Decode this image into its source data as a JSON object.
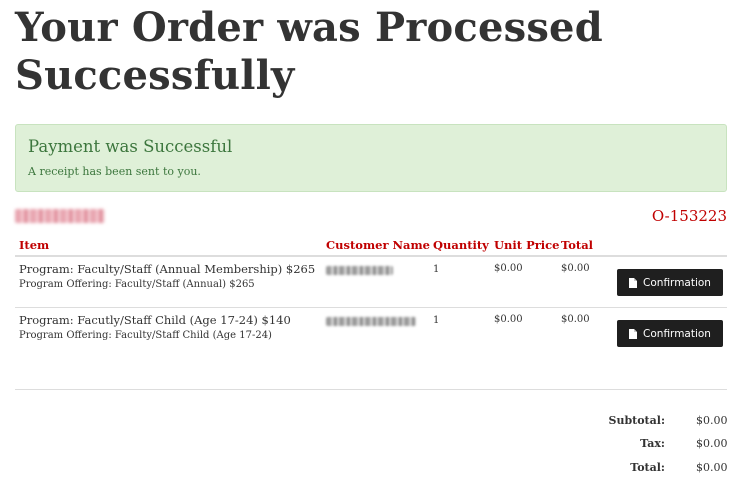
{
  "page": {
    "title": "Your Order was Processed Successfully"
  },
  "alert": {
    "title": "Payment was Successful",
    "message": "A receipt has been sent to you."
  },
  "order": {
    "number": "O-153223"
  },
  "table": {
    "headers": {
      "item": "Item",
      "customer_name": "Customer Name",
      "quantity": "Quantity",
      "unit_price": "Unit Price",
      "total": "Total"
    },
    "rows": [
      {
        "item": "Program: Faculty/Staff (Annual Membership) $265",
        "offering": "Program Offering: Faculty/Staff (Annual) $265",
        "quantity": "1",
        "unit_price": "$0.00",
        "total": "$0.00",
        "button_label": "Confirmation"
      },
      {
        "item": "Program: Facutly/Staff Child (Age 17-24) $140",
        "offering": "Program Offering: Faculty/Staff Child (Age 17-24)",
        "quantity": "1",
        "unit_price": "$0.00",
        "total": "$0.00",
        "button_label": "Confirmation"
      }
    ]
  },
  "summary": {
    "subtotal_label": "Subtotal:",
    "subtotal_value": "$0.00",
    "tax_label": "Tax:",
    "tax_value": "$0.00",
    "total_label": "Total:",
    "total_value": "$0.00"
  },
  "colors": {
    "accent": "#c00000",
    "success_bg": "#dff0d8",
    "success_text": "#3c763d",
    "button_bg": "#1f1f1f"
  },
  "icons": {
    "confirmation_button_icon": "document-icon"
  }
}
